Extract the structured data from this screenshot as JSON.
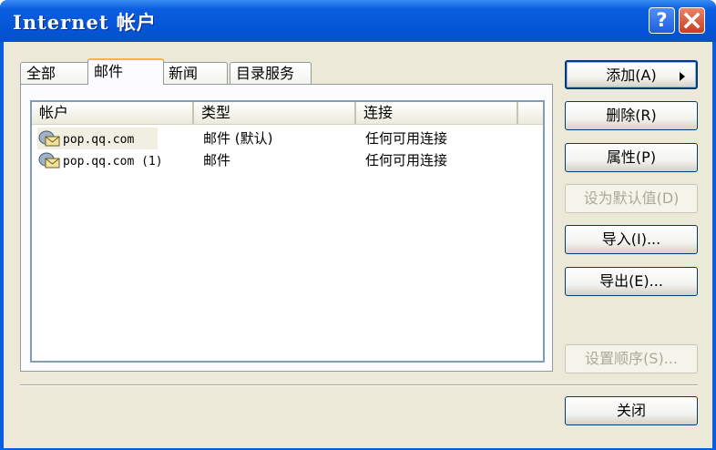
{
  "window": {
    "title": "Internet 帐户",
    "help_glyph": "?",
    "close_icon": "close-icon"
  },
  "tabs": [
    "全部",
    "邮件",
    "新闻",
    "目录服务"
  ],
  "active_tab": "邮件",
  "list": {
    "columns": [
      "帐户",
      "类型",
      "连接"
    ],
    "rows": [
      {
        "account": "pop.qq.com",
        "type": "邮件 (默认)",
        "connection": "任何可用连接",
        "icon": "mail-account-icon"
      },
      {
        "account": "pop.qq.com (1)",
        "type": "邮件",
        "connection": "任何可用连接",
        "icon": "mail-account-icon"
      }
    ]
  },
  "buttons": {
    "add": "添加(A)",
    "remove": "删除(R)",
    "properties": "属性(P)",
    "set_default": "设为默认值(D)",
    "import": "导入(I)...",
    "export": "导出(E)...",
    "set_order": "设置顺序(S)...",
    "close": "关闭"
  },
  "colors": {
    "title_bar": "#0a5ede",
    "dialog_bg": "#ece9d8",
    "active_tab_accent": "#f4b63b"
  }
}
